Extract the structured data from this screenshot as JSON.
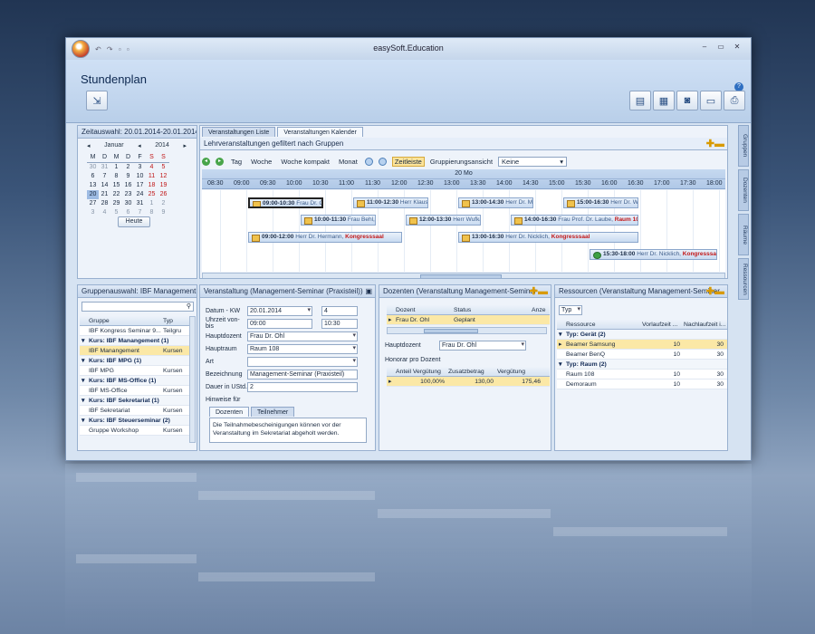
{
  "window": {
    "title": "easySoft.Education",
    "quick_access": "↶ ↷ ▫ ▫",
    "controls": [
      "–",
      "▭",
      "✕"
    ],
    "help": "?"
  },
  "ribbon": {
    "page_title": "Stundenplan"
  },
  "calendar_panel": {
    "header": "Zeitauswahl: 20.01.2014-20.01.2014",
    "month": "Januar",
    "year": "2014",
    "prev": "◂",
    "next": "▸",
    "weekdays": [
      "M",
      "D",
      "M",
      "D",
      "F",
      "S",
      "S"
    ],
    "weeks": [
      [
        "30",
        "31",
        "1",
        "2",
        "3",
        "4",
        "5"
      ],
      [
        "6",
        "7",
        "8",
        "9",
        "10",
        "11",
        "12"
      ],
      [
        "13",
        "14",
        "15",
        "16",
        "17",
        "18",
        "19"
      ],
      [
        "20",
        "21",
        "22",
        "23",
        "24",
        "25",
        "26"
      ],
      [
        "27",
        "28",
        "29",
        "30",
        "31",
        "1",
        "2"
      ],
      [
        "3",
        "4",
        "5",
        "6",
        "7",
        "8",
        "9"
      ]
    ],
    "today_button": "Heute"
  },
  "calendar_view": {
    "tabs": [
      "Veranstaltungen Liste",
      "Veranstaltungen Kalender"
    ],
    "header": "Lehrveranstaltungen gefiltert nach Gruppen",
    "toolbar": {
      "tag": "Tag",
      "woche": "Woche",
      "woche_kompakt": "Woche kompakt",
      "monat": "Monat",
      "zeitleiste": "Zeitleiste",
      "gruppierung_label": "Gruppierungsansicht",
      "gruppierung_value": "Keine"
    },
    "day_label": "20 Mo",
    "hours": [
      "08:30",
      "09:00",
      "09:30",
      "10:00",
      "10:30",
      "11:00",
      "11:30",
      "12:00",
      "12:30",
      "13:00",
      "13:30",
      "14:00",
      "14:30",
      "15:00",
      "15:30",
      "16:00",
      "16:30",
      "17:00",
      "17:30",
      "18:00"
    ],
    "appointments": [
      {
        "time": "09:00-10:30",
        "person": "Frau Dr. Ohl",
        "room": ""
      },
      {
        "time": "11:00-12:30",
        "person": "Herr Klausen,",
        "room": ""
      },
      {
        "time": "13:00-14:30",
        "person": "Herr Dr. Mehl,",
        "room": ""
      },
      {
        "time": "15:00-16:30",
        "person": "Herr Dr. Wald,",
        "room": ""
      },
      {
        "time": "10:00-11:30",
        "person": "Frau Behl,",
        "room": ""
      },
      {
        "time": "12:00-13:30",
        "person": "Herr Wufka,",
        "room": ""
      },
      {
        "time": "14:00-16:30",
        "person": "Frau Prof. Dr. Laube,",
        "room": "Raum 109"
      },
      {
        "time": "09:00-12:00",
        "person": "Herr Dr. Hermann,",
        "room": "Kongresssaal"
      },
      {
        "time": "13:00-16:30",
        "person": "Herr Dr. Nicklich,",
        "room": "Kongresssaal"
      },
      {
        "time": "15:30-18:00",
        "person": "Herr Dr. Nicklich,",
        "room": "Kongresssaal"
      }
    ],
    "side_tabs": [
      "Gruppen",
      "Dozenten",
      "Räume",
      "Ressourcen"
    ]
  },
  "group_panel": {
    "header": "Gruppenauswahl: IBF Management",
    "columns": [
      "Gruppe",
      "Typ"
    ],
    "rows": [
      {
        "kind": "item",
        "name": "IBF Kongress Seminar 9...",
        "typ": "Teilgru"
      },
      {
        "kind": "group",
        "name": "Kurs: IBF Manangement (1)",
        "typ": ""
      },
      {
        "kind": "item",
        "name": "IBF Manangement",
        "typ": "Kursen",
        "hl": true
      },
      {
        "kind": "group",
        "name": "Kurs: IBF MPG (1)",
        "typ": ""
      },
      {
        "kind": "item",
        "name": "IBF MPG",
        "typ": "Kursen"
      },
      {
        "kind": "group",
        "name": "Kurs: IBF MS-Office (1)",
        "typ": ""
      },
      {
        "kind": "item",
        "name": "IBF MS-Office",
        "typ": "Kursen"
      },
      {
        "kind": "group",
        "name": "Kurs: IBF Sekretariat (1)",
        "typ": ""
      },
      {
        "kind": "item",
        "name": "IBF Sekretariat",
        "typ": "Kursen"
      },
      {
        "kind": "group",
        "name": "Kurs: IBF Steuerseminar (2)",
        "typ": ""
      },
      {
        "kind": "item",
        "name": "Gruppe Workshop",
        "typ": "Kursen"
      }
    ]
  },
  "event_panel": {
    "header": "Veranstaltung (Management-Seminar (Praxisteil))",
    "labels": {
      "datum_kw": "Datum - KW",
      "uhrzeit": "Uhrzeit von-bis",
      "hauptdozent": "Hauptdozent",
      "hauptraum": "Hauptraum",
      "art": "Art",
      "bezeichnung": "Bezeichnung",
      "dauer": "Dauer in UStd.",
      "hinweise": "Hinweise für"
    },
    "values": {
      "datum": "20.01.2014",
      "kw": "4",
      "von": "09:00",
      "bis": "10:30",
      "hauptdozent": "Frau Dr. Ohl",
      "hauptraum": "Raum 108",
      "art": "",
      "bezeichnung": "Management-Seminar (Praxisteil)",
      "dauer": "2"
    },
    "note_tabs": [
      "Dozenten",
      "Teilnehmer"
    ],
    "note_text": "Die Teilnahmebescheinigungen können vor der Veranstaltung im Sekretariat abgeholt werden."
  },
  "lecturer_panel": {
    "header": "Dozenten (Veranstaltung Management-Seminar",
    "columns": [
      "Dozent",
      "Status",
      "Anze"
    ],
    "rows": [
      {
        "dozent": "Frau Dr. Ohl",
        "status": "Geplant",
        "anz": ""
      }
    ],
    "hauptdozent_label": "Hauptdozent",
    "hauptdozent_value": "Frau Dr. Ohl",
    "honorar_label": "Honorar pro Dozent",
    "honorar_columns": [
      "Anteil Vergütung",
      "Zusatzbetrag",
      "Vergütung"
    ],
    "honorar_row": [
      "100,00%",
      "130,00",
      "175,46"
    ]
  },
  "resource_panel": {
    "header": "Ressourcen (Veranstaltung Management-Seminar",
    "filter": "Typ",
    "columns": [
      "Ressource",
      "Vorlaufzeit ...",
      "Nachlaufzeit i..."
    ],
    "rows": [
      {
        "kind": "group",
        "name": "Typ: Gerät (2)",
        "vor": "",
        "nach": ""
      },
      {
        "kind": "item",
        "name": "Beamer Samsung",
        "vor": "10",
        "nach": "30",
        "hl": true
      },
      {
        "kind": "item",
        "name": "Beamer BenQ",
        "vor": "10",
        "nach": "30"
      },
      {
        "kind": "group",
        "name": "Typ: Raum (2)",
        "vor": "",
        "nach": ""
      },
      {
        "kind": "item",
        "name": "Raum 108",
        "vor": "10",
        "nach": "30"
      },
      {
        "kind": "item",
        "name": "Demoraum",
        "vor": "10",
        "nach": "30"
      }
    ]
  }
}
